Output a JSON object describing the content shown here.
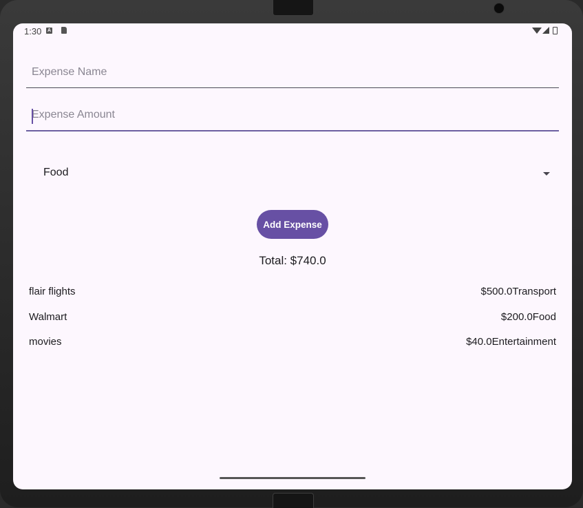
{
  "status_bar": {
    "time": "1:30",
    "notification_icons": [
      "accessibility-icon",
      "sd-card-icon"
    ],
    "system_icons": [
      "wifi-icon",
      "cell-signal-icon",
      "battery-icon"
    ]
  },
  "form": {
    "name_field": {
      "placeholder": "Expense Name",
      "value": ""
    },
    "amount_field": {
      "placeholder": "Expense Amount",
      "value": ""
    },
    "category_dropdown": {
      "selected": "Food",
      "icon": "dropdown-arrow-icon"
    },
    "add_button_label": "Add Expense"
  },
  "total_label": "Total: $740.0",
  "expenses": [
    {
      "name": "flair flights",
      "amount_category": "$500.0Transport"
    },
    {
      "name": "Walmart",
      "amount_category": "$200.0Food"
    },
    {
      "name": "movies",
      "amount_category": "$40.0Entertainment"
    }
  ],
  "colors": {
    "accent": "#6750a4",
    "background": "#fdf7fe",
    "text": "#1c1b1f"
  }
}
